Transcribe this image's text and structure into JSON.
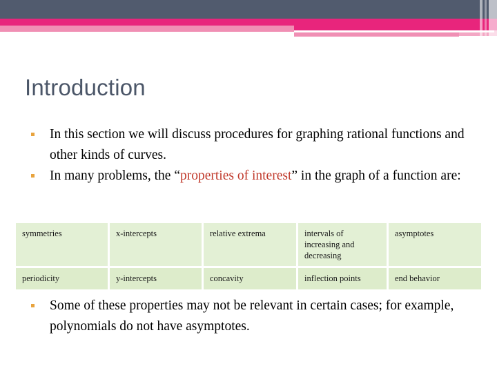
{
  "header": {
    "colors": {
      "slate": "#515b6e",
      "magenta": "#e8257c",
      "pink": "#f08fb4",
      "pink_light": "#f3a7c4"
    }
  },
  "title": "Introduction",
  "bullets_top": [
    {
      "segments": [
        {
          "text": "In this section we will discuss procedures for graphing rational functions and other kinds of curves.",
          "style": "normal"
        }
      ]
    },
    {
      "segments": [
        {
          "text": "In many problems, the ",
          "style": "normal"
        },
        {
          "text": "“",
          "style": "quote"
        },
        {
          "text": "properties of interest",
          "style": "red"
        },
        {
          "text": "”",
          "style": "quote"
        },
        {
          "text": " in the graph of a function are:",
          "style": "normal"
        }
      ]
    }
  ],
  "table": {
    "rows": [
      {
        "cells": [
          "symmetries",
          "x-intercepts",
          "relative extrema",
          "intervals of increasing and decreasing",
          "asymptotes"
        ]
      },
      {
        "cells": [
          "periodicity",
          "y-intercepts",
          "concavity",
          "inflection points",
          "end behavior"
        ]
      }
    ]
  },
  "bullets_bottom": [
    {
      "segments": [
        {
          "text": "Some of these properties may not be relevant in certain cases; for example, polynomials do not have asymptotes.",
          "style": "normal"
        }
      ]
    }
  ],
  "bullet_marker_color": "#e8a33d",
  "highlight_color": "#c0392b"
}
